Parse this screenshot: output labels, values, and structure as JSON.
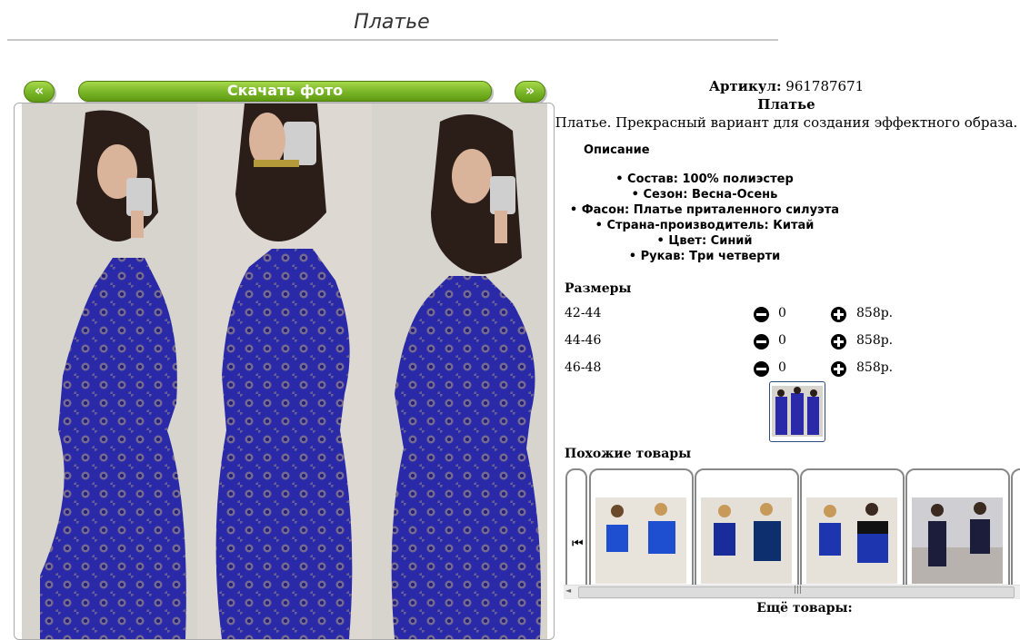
{
  "page": {
    "title": "Платье"
  },
  "nav": {
    "prev_label": "«",
    "download_label": "Скачать фото",
    "next_label": "»"
  },
  "product": {
    "article_label": "Артикул:",
    "article_value": "961787671",
    "name": "Платье",
    "description": "Платье. Прекрасный вариант для создания эффектного образа.",
    "description_heading": "Описание",
    "properties": [
      "Состав: 100% полиэстер",
      "Сезон: Весна-Осень",
      "Фасон: Платье приталенного силуэта",
      "Страна-производитель: Китай",
      "Цвет: Синий",
      "Рукав: Три четверти"
    ]
  },
  "sizes": {
    "heading": "Размеры",
    "rows": [
      {
        "size": "42-44",
        "qty": "0",
        "price": "858р."
      },
      {
        "size": "44-46",
        "qty": "0",
        "price": "858р."
      },
      {
        "size": "46-48",
        "qty": "0",
        "price": "858р."
      }
    ]
  },
  "similar": {
    "heading": "Похожие товары",
    "scroll_left_icon": "skip-back-icon"
  },
  "more": {
    "heading": "Ещё товары:"
  },
  "colors": {
    "button_green": "#7cb82a",
    "dress_blue": "#2a2aa8",
    "lining_beige": "#b49d80"
  }
}
